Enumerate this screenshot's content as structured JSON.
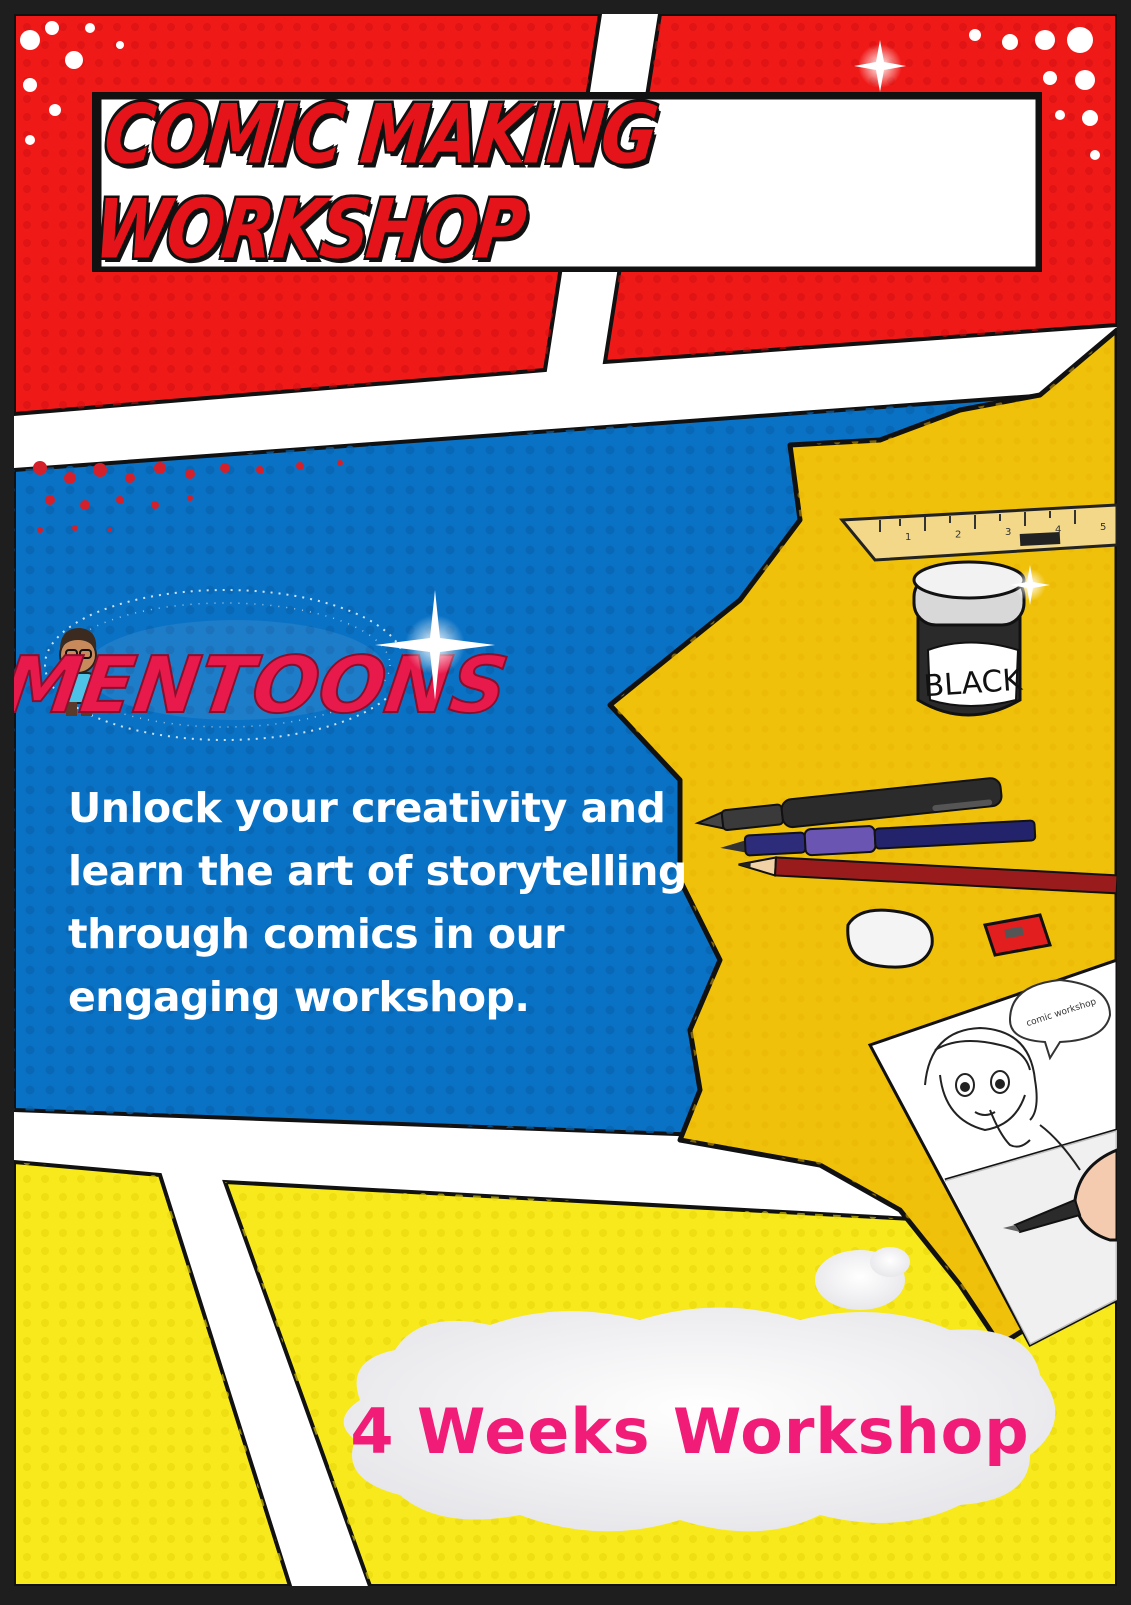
{
  "poster": {
    "title": "Comic Making Workshop",
    "brand": "MENTOONS",
    "blurb": "Unlock your creativity and learn the art of storytelling through comics in our engaging workshop.",
    "duration": "4 Weeks Workshop"
  },
  "illustration": {
    "ink_jar_label": "BLACK",
    "sketch_speech_bubble": "comic workshop",
    "ruler_ticks": [
      "1",
      "2",
      "3",
      "4",
      "5"
    ]
  },
  "colors": {
    "red_panel": "#ef1a18",
    "blue_panel": "#0a72c5",
    "yellow_panel": "#f7e91b",
    "burst_gold": "#f0c10a",
    "title_red": "#e5141b",
    "duration_pink": "#f01c78",
    "border": "#1e1e1e"
  }
}
